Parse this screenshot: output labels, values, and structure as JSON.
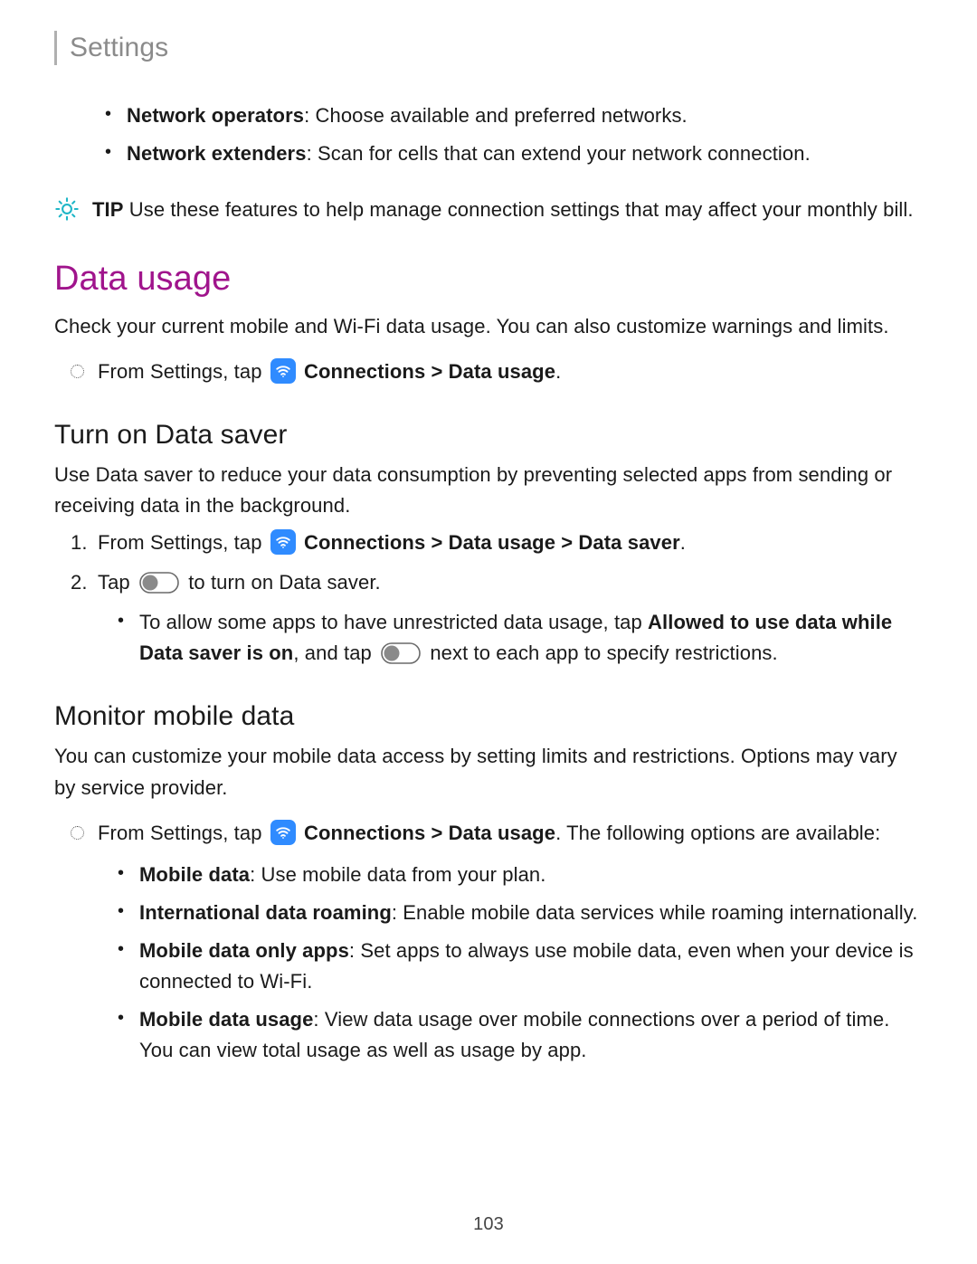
{
  "header": {
    "title": "Settings"
  },
  "topBullets": [
    {
      "term": "Network operators",
      "desc": ": Choose available and preferred networks."
    },
    {
      "term": "Network extenders",
      "desc": ": Scan for cells that can extend your network connection."
    }
  ],
  "tip": {
    "label": "TIP",
    "text": "  Use these features to help manage connection settings that may affect your monthly bill."
  },
  "dataUsage": {
    "heading": "Data usage",
    "intro": "Check your current mobile and Wi-Fi data usage. You can also customize warnings and limits.",
    "navPrefix": "From Settings, tap ",
    "navPath": "Connections > Data usage",
    "navSuffix": "."
  },
  "dataSaver": {
    "heading": "Turn on Data saver",
    "intro": "Use Data saver to reduce your data consumption by preventing selected apps from sending or receiving data in the background.",
    "step1Prefix": "From Settings, tap ",
    "step1Path": "Connections > Data usage > Data saver",
    "step1Suffix": ".",
    "step2a": "Tap ",
    "step2b": " to turn on Data saver.",
    "subA": "To allow some apps to have unrestricted data usage, tap ",
    "subBold": "Allowed to use data while Data saver is on",
    "subB": ", and tap ",
    "subC": " next to each app to specify restrictions."
  },
  "monitor": {
    "heading": "Monitor mobile data",
    "intro": "You can customize your mobile data access by setting limits and restrictions. Options may vary by service provider.",
    "navPrefix": "From Settings, tap ",
    "navPath": "Connections > Data usage",
    "navSuffix": ". ",
    "navTrail": "The following options are available:",
    "options": [
      {
        "term": "Mobile data",
        "desc": ": Use mobile data from your plan."
      },
      {
        "term": "International data roaming",
        "desc": ": Enable mobile data services while roaming internationally."
      },
      {
        "term": "Mobile data only apps",
        "desc": ": Set apps to always use mobile data, even when your device is connected to Wi-Fi."
      },
      {
        "term": "Mobile data usage",
        "desc": ": View data usage over mobile connections over a period of time. You can view total usage as well as usage by app."
      }
    ]
  },
  "pageNumber": "103"
}
